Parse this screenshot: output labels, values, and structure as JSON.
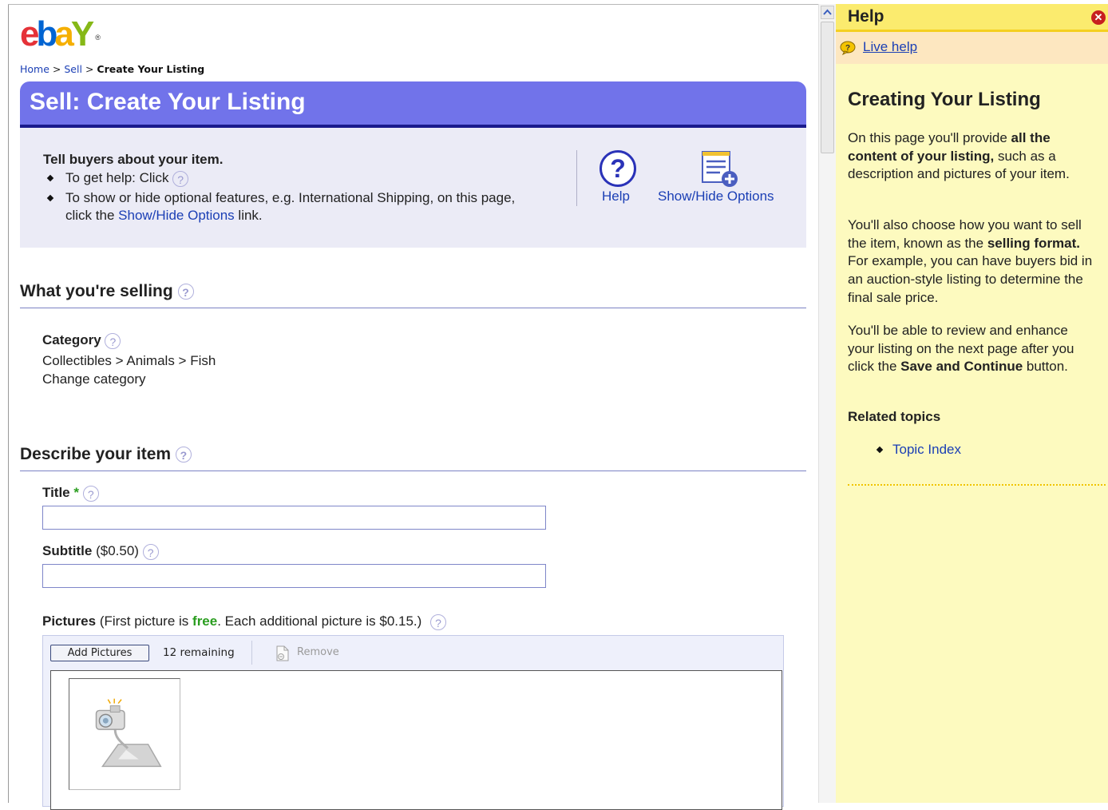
{
  "logo": {
    "brand": "ebay",
    "reg_mark": "®"
  },
  "breadcrumb": {
    "home": "Home",
    "sep": ">",
    "sell": "Sell",
    "current": "Create Your Listing"
  },
  "page_title": "Sell: Create Your Listing",
  "intro": {
    "heading": "Tell buyers about your item.",
    "bullet1": "To get help: Click",
    "bullet2_a": "To show or hide optional features, e.g. International Shipping, on this page,",
    "bullet2_b_prefix": "click the",
    "bullet2_b_link": "Show/Hide Options",
    "bullet2_b_suffix": "link.",
    "help_label": "Help",
    "showhide_label": "Show/Hide Options"
  },
  "section_selling": {
    "title": "What you're selling",
    "category_label": "Category",
    "category_path": "Collectibles > Animals > Fish",
    "change_link": "Change category"
  },
  "section_describe": {
    "title": "Describe your item",
    "title_label": "Title",
    "required_mark": "*",
    "title_value": "",
    "subtitle_label": "Subtitle",
    "subtitle_fee": "($0.50)",
    "subtitle_value": "",
    "pictures_label": "Pictures",
    "pictures_note_a": "(First picture is",
    "pictures_note_free": "free",
    "pictures_note_b": ". Each additional picture is $0.15.)",
    "add_pictures": "Add Pictures",
    "remaining": "12 remaining",
    "remove": "Remove"
  },
  "help_panel": {
    "header": "Help",
    "close": "x",
    "live_help": "Live help",
    "topic_title": "Creating Your Listing",
    "para1": "On this page you'll provide <b>all the content of your listing,</b> such as a description and pictures of your item.",
    "para2": "You'll also choose how you want to sell the item, known as the <b>selling format.</b> For example, you can have buyers bid in an auction-style listing to determine the final sale price.",
    "para3": "You'll be able to review and enhance your listing on the next page after you click the <b>Save and Continue</b> button.",
    "related_title": "Related topics",
    "related_links": [
      "Topic Index"
    ]
  },
  "colors": {
    "title_bar": "#7173ea",
    "title_bar_underline": "#1a1a8c",
    "intro_bg": "#ebebf6",
    "link": "#1b3fb5",
    "free_green": "#2a9d1f",
    "help_bg": "#fdfabf",
    "help_header": "#fbeb6e"
  },
  "icons": {
    "help_big": "question-circle-icon",
    "showhide": "list-add-icon",
    "live_help": "speech-bubble-icon",
    "close": "close-circle-icon",
    "remove": "document-remove-icon",
    "picture_placeholder": "camera-picture-icon"
  }
}
